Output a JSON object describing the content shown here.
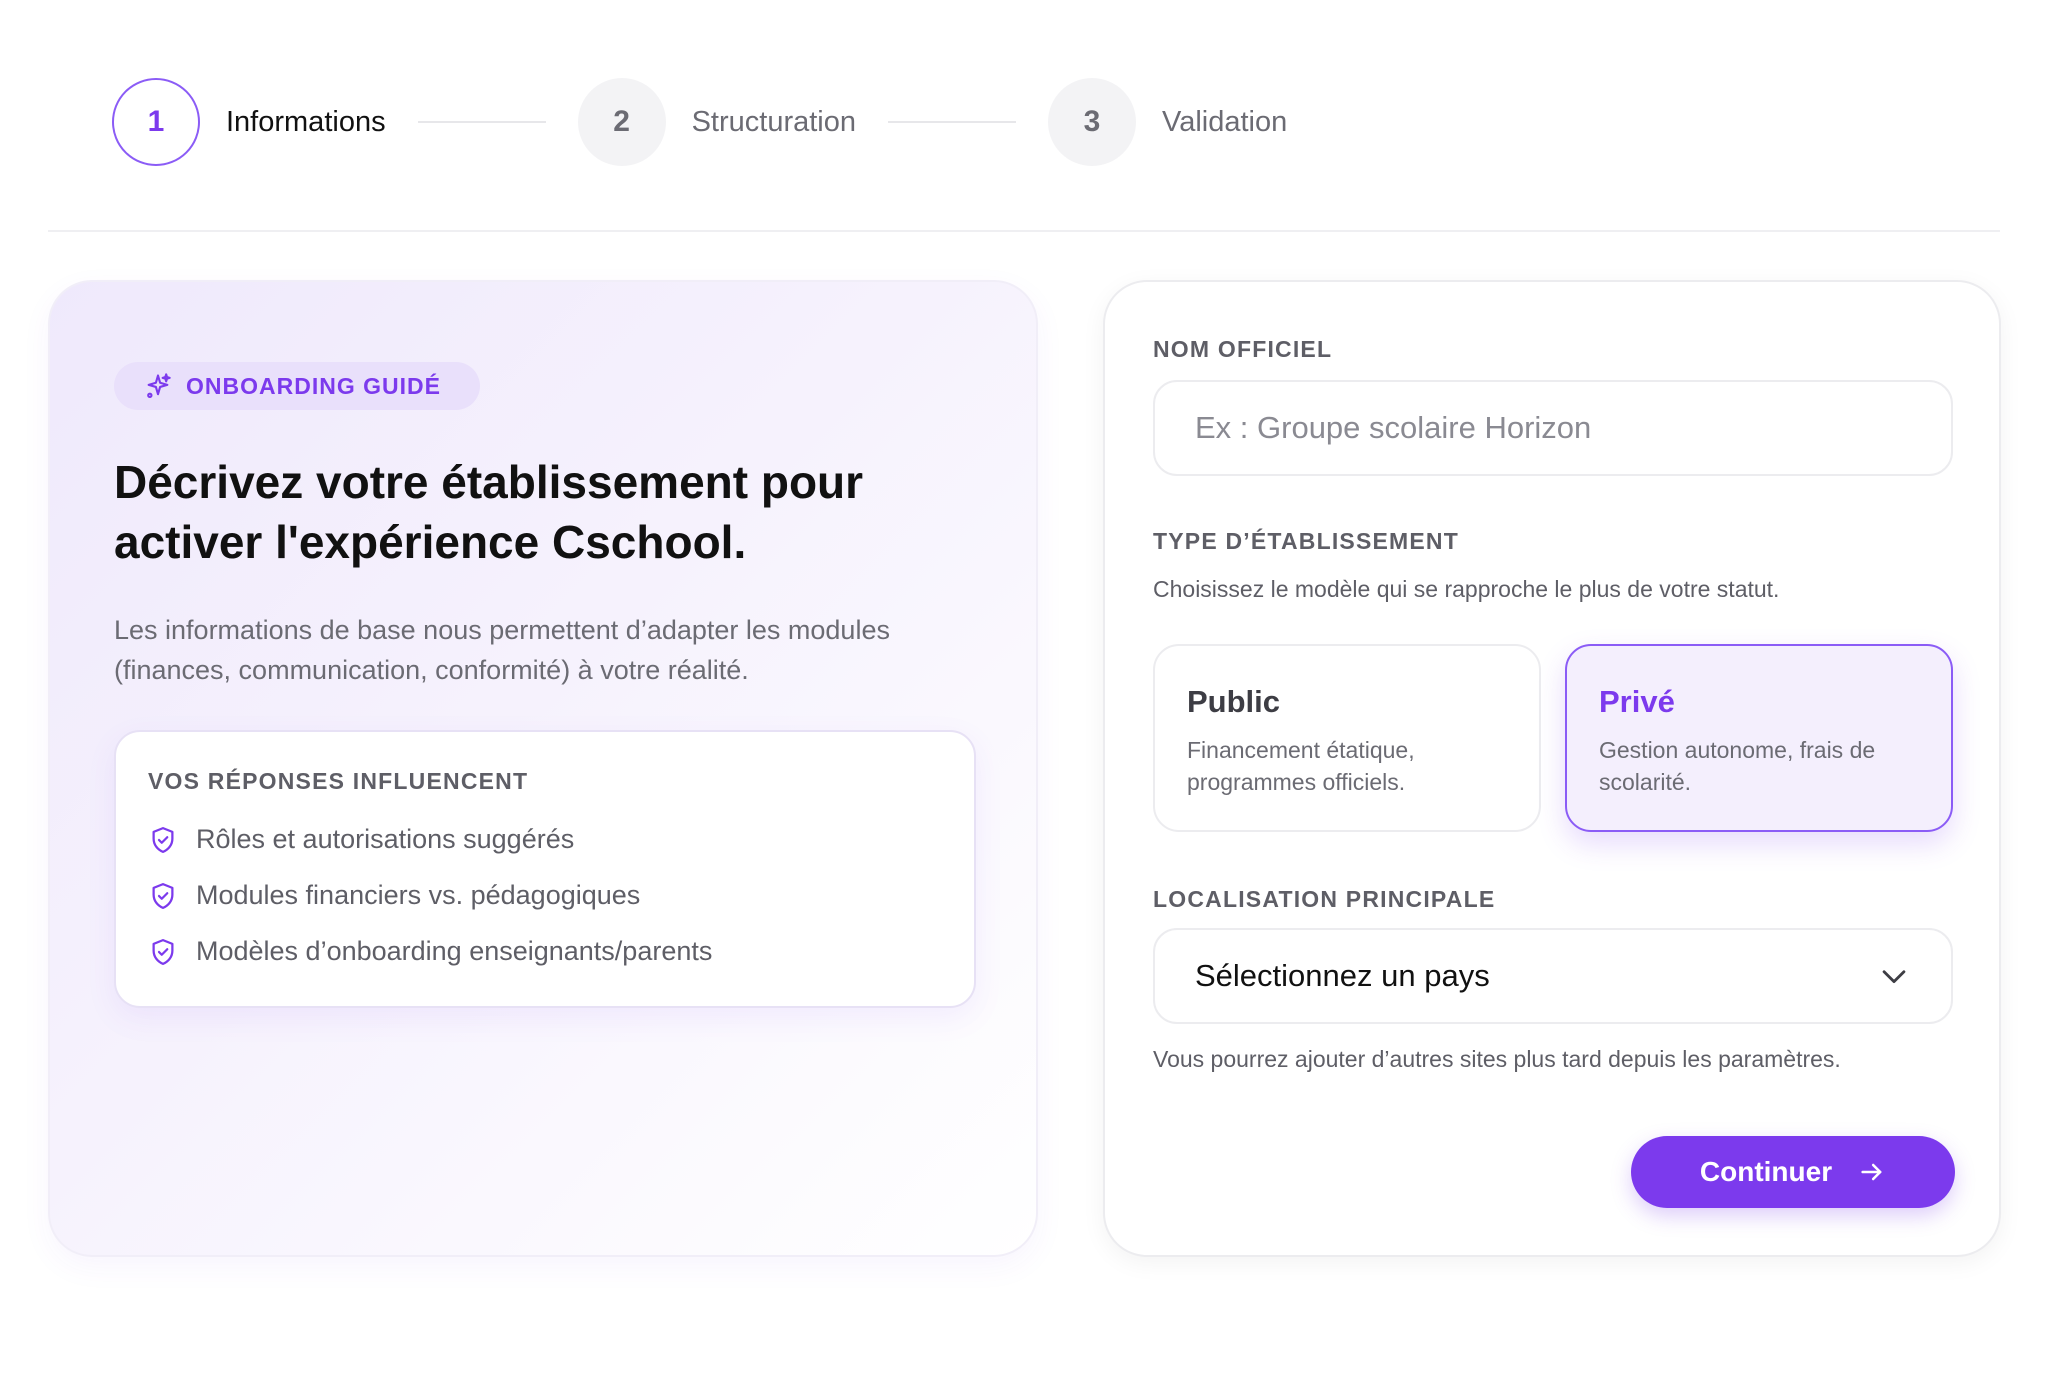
{
  "stepper": {
    "steps": [
      {
        "number": "1",
        "label": "Informations",
        "state": "active"
      },
      {
        "number": "2",
        "label": "Structuration",
        "state": "upcoming"
      },
      {
        "number": "3",
        "label": "Validation",
        "state": "upcoming"
      }
    ]
  },
  "intro": {
    "badge": "ONBOARDING GUIDÉ",
    "badge_icon": "sparkles-icon",
    "headline_line1": "Décrivez votre établissement pour",
    "headline_line2": "activer l'expérience Cschool.",
    "lead_line1": "Les informations de base nous permettent d’adapter les modules",
    "lead_line2": "(finances, communication, conformité) à votre réalité.",
    "influence": {
      "title": "VOS RÉPONSES INFLUENCENT",
      "item_icon": "shield-check-icon",
      "items": [
        "Rôles et autorisations suggérés",
        "Modules financiers vs. pédagogiques",
        "Modèles d’onboarding enseignants/parents"
      ]
    }
  },
  "form": {
    "name_label": "NOM OFFICIEL",
    "name_placeholder": "Ex : Groupe scolaire Horizon",
    "name_value": "",
    "type_label": "TYPE D’ÉTABLISSEMENT",
    "type_hint": "Choisissez le modèle qui se rapproche le plus de votre statut.",
    "types": [
      {
        "title": "Public",
        "desc": "Financement étatique, programmes officiels.",
        "selected": false
      },
      {
        "title": "Privé",
        "desc": "Gestion autonome, frais de scolarité.",
        "selected": true
      }
    ],
    "location_label": "LOCALISATION PRINCIPALE",
    "location_selected": "Sélectionnez un pays",
    "location_hint": "Vous pourrez ajouter d’autres sites plus tard depuis les paramètres.",
    "continue_label": "Continuer",
    "continue_icon": "arrow-right-icon"
  },
  "colors": {
    "accent": "#7c3aed",
    "accent_light": "#f4effd",
    "muted_text": "#6b6b73"
  }
}
